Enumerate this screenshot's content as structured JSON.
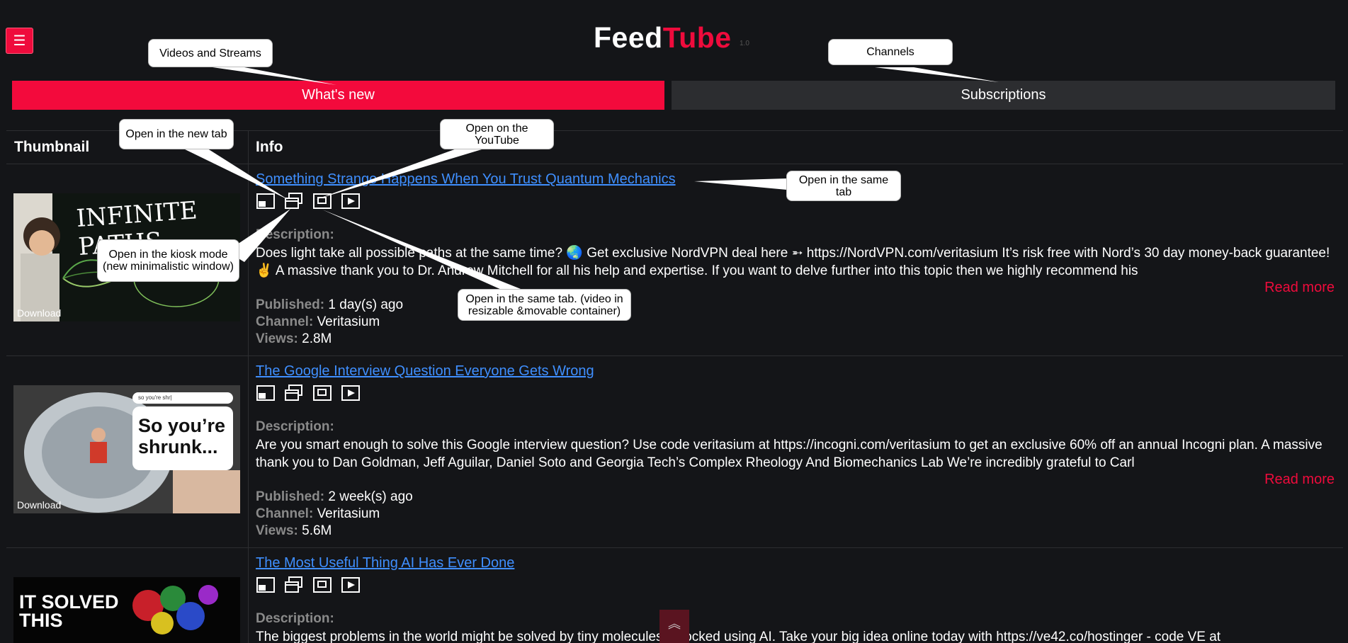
{
  "app": {
    "logo_part1": "Feed",
    "logo_part2": "Tube",
    "logo_sup": "1.0",
    "menu_icon": "☰"
  },
  "tabs": {
    "whats_new": "What's new",
    "subscriptions": "Subscriptions"
  },
  "table": {
    "col_thumbnail": "Thumbnail",
    "col_info": "Info"
  },
  "labels": {
    "description": "Description:",
    "published": "Published:",
    "channel": "Channel:",
    "views": "Views:",
    "read_more": "Read more",
    "download": "Download"
  },
  "videos": [
    {
      "title": "Something Strange Happens When You Trust Quantum Mechanics",
      "thumb_text": "INFINITE PATHS",
      "description": "Does light take all possible paths at the same time? 🌏 Get exclusive NordVPN deal here ➵ https://NordVPN.com/veritasium It’s risk free with Nord’s 30 day money-back guarantee!✌ A massive thank you to Dr. Andrew Mitchell for all his help and expertise. If you want to delve further into this topic then we highly recommend his",
      "published": "1 day(s) ago",
      "channel": "Veritasium",
      "views": "2.8M"
    },
    {
      "title": "The Google Interview Question Everyone Gets Wrong",
      "thumb_text": "So you’re shrunk...",
      "thumb_search": "so you're shr|",
      "description": "Are you smart enough to solve this Google interview question? Use code veritasium at https://incogni.com/veritasium to get an exclusive 60% off an annual Incogni plan. A massive thank you to Dan Goldman, Jeff Aguilar, Daniel Soto and Georgia Tech’s Complex Rheology And Biomechanics Lab We’re incredibly grateful to Carl",
      "published": "2 week(s) ago",
      "channel": "Veritasium",
      "views": "5.6M"
    },
    {
      "title": "The Most Useful Thing AI Has Ever Done",
      "thumb_text": "IT SOLVED THIS",
      "description": "The biggest problems in the world might be solved by tiny molecules unlocked using AI. Take your big idea online today with https://ve42.co/hostinger - code VE at"
    }
  ],
  "callouts": {
    "videos_and_streams": "Videos and Streams",
    "channels": "Channels",
    "open_new_tab": "Open in the new tab",
    "open_youtube": "Open on the YouTube",
    "open_same_tab": "Open in the same tab",
    "open_kiosk": "Open in the kiosk mode (new minimalistic window)",
    "open_container": "Open in the same tab. (video in resizable &movable container)"
  },
  "icons": [
    "kiosk-window-icon",
    "new-tab-icon",
    "container-icon",
    "youtube-play-icon",
    "scroll-to-top-icon",
    "menu-icon"
  ],
  "colors": {
    "background": "#141518",
    "accent": "#ef0b3c",
    "link": "#3f8fff",
    "muted": "#8a8a8a",
    "tab_inactive": "#2c2d30"
  },
  "scroll_top_icon": "︽"
}
